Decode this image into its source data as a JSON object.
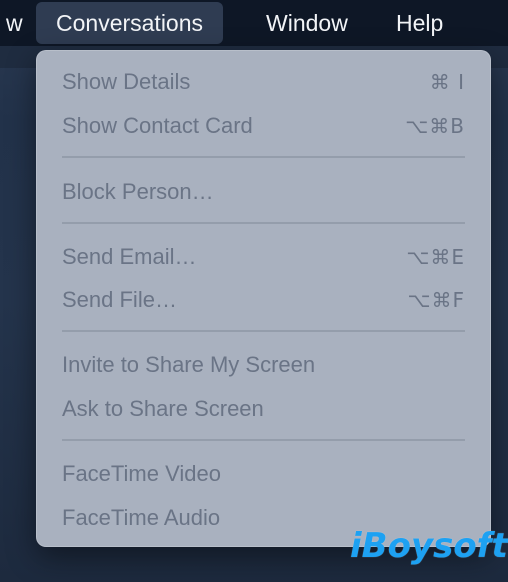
{
  "menubar": {
    "items": [
      {
        "label": "w"
      },
      {
        "label": "Conversations"
      },
      {
        "label": "Window"
      },
      {
        "label": "Help"
      }
    ]
  },
  "menu": {
    "groups": [
      {
        "items": [
          {
            "label": "Show Details",
            "shortcut": "⌘ I"
          },
          {
            "label": "Show Contact Card",
            "shortcut": "⌥⌘B"
          }
        ]
      },
      {
        "items": [
          {
            "label": "Block Person…",
            "shortcut": ""
          }
        ]
      },
      {
        "items": [
          {
            "label": "Send Email…",
            "shortcut": "⌥⌘E"
          },
          {
            "label": "Send File…",
            "shortcut": "⌥⌘F"
          }
        ]
      },
      {
        "items": [
          {
            "label": "Invite to Share My Screen",
            "shortcut": ""
          },
          {
            "label": "Ask to Share Screen",
            "shortcut": ""
          }
        ]
      },
      {
        "items": [
          {
            "label": "FaceTime Video",
            "shortcut": ""
          },
          {
            "label": "FaceTime Audio",
            "shortcut": ""
          }
        ]
      }
    ]
  },
  "watermark": {
    "text": "iBoysoft"
  },
  "colors": {
    "menubar_bg": "#0e1726",
    "menu_bg": "#a9b1bf",
    "disabled_text": "#6a7486",
    "watermark": "#1da1f2"
  }
}
